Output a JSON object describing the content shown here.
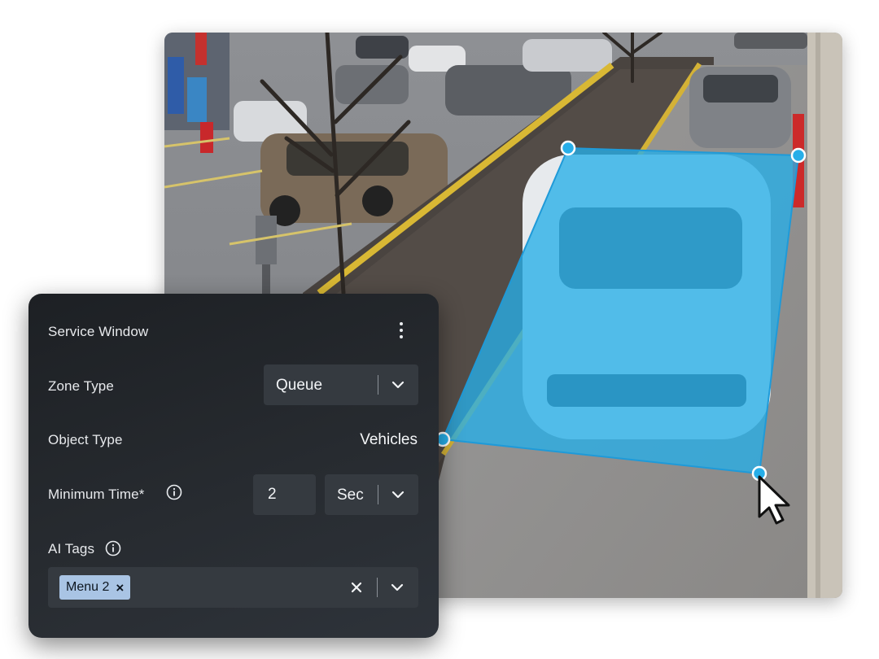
{
  "panel": {
    "title": "Service Window",
    "menu_icon": "kebab-vertical-icon",
    "zone_type": {
      "label": "Zone Type",
      "value": "Queue"
    },
    "object_type": {
      "label": "Object Type",
      "value": "Vehicles"
    },
    "minimum_time": {
      "label": "Minimum Time*",
      "value": "2",
      "unit": "Sec",
      "icon": "info-icon"
    },
    "ai_tags": {
      "label": "AI Tags",
      "icon": "info-icon",
      "tags": [
        "Menu 2"
      ],
      "tag_remove_glyph": "×"
    }
  },
  "colors": {
    "panel_bg": "#272b30",
    "field_bg": "#353a40",
    "zone_fill": "#27aee8",
    "zone_handle": "#1fa4e6",
    "chip_bg": "#a9c4e4"
  }
}
